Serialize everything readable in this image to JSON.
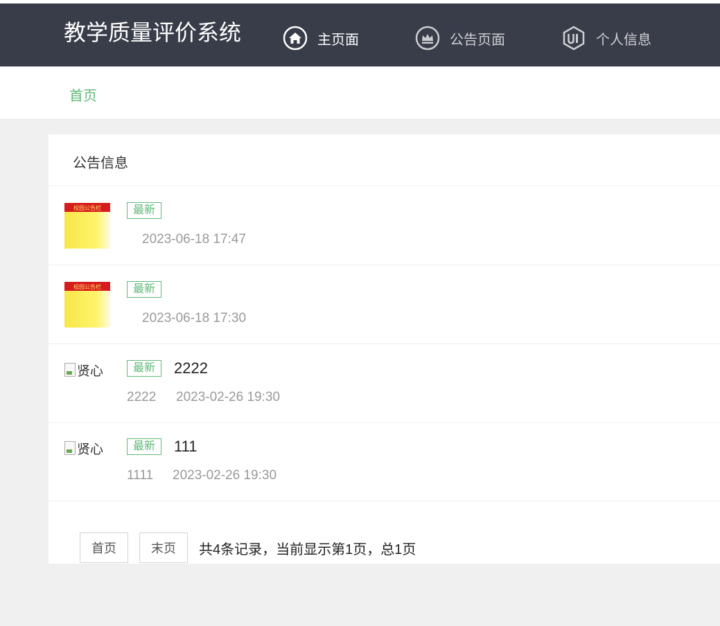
{
  "header": {
    "title": "教学质量评价系统",
    "nav": [
      {
        "label": "主页面",
        "icon": "home-icon"
      },
      {
        "label": "公告页面",
        "icon": "crown-icon"
      },
      {
        "label": "个人信息",
        "icon": "ui-icon"
      }
    ]
  },
  "breadcrumb": {
    "label": "首页"
  },
  "card": {
    "title": "公告信息"
  },
  "notices": [
    {
      "badge": "最新",
      "title": "",
      "summary": "",
      "date": "2023-06-18 17:47",
      "image": "校园公告栏"
    },
    {
      "badge": "最新",
      "title": "",
      "summary": "",
      "date": "2023-06-18 17:30",
      "image": "校园公告栏"
    },
    {
      "badge": "最新",
      "title": "2222",
      "summary": "2222",
      "date": "2023-02-26 19:30",
      "image_alt": "贤心"
    },
    {
      "badge": "最新",
      "title": "111",
      "summary": "1111",
      "date": "2023-02-26 19:30",
      "image_alt": "贤心"
    }
  ],
  "pager": {
    "first": "首页",
    "last": "末页",
    "info": "共4条记录，当前显示第1页，总1页"
  },
  "colors": {
    "header_bg": "#393d49",
    "accent_green": "#5fb878",
    "page_bg": "#f0f0f0"
  }
}
